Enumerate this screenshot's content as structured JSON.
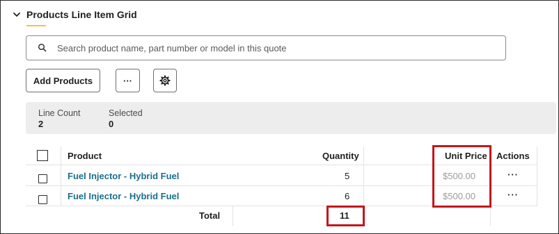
{
  "section": {
    "title": "Products Line Item Grid",
    "chevron_icon": "chevron-down-icon"
  },
  "search": {
    "placeholder": "Search product name, part number or model in this quote",
    "value": "",
    "icon": "search-icon"
  },
  "toolbar": {
    "add_label": "Add Products",
    "more_label": "···",
    "settings_icon": "gear-icon"
  },
  "summary": {
    "line_count_label": "Line Count",
    "line_count_value": "2",
    "selected_label": "Selected",
    "selected_value": "0"
  },
  "table": {
    "columns": {
      "product": "Product",
      "quantity": "Quantity",
      "unit_price": "Unit Price",
      "actions": "Actions"
    },
    "rows": [
      {
        "product": "Fuel Injector - Hybrid Fuel",
        "quantity": "5",
        "unit_price": "$500.00",
        "actions": "···"
      },
      {
        "product": "Fuel Injector - Hybrid Fuel",
        "quantity": "6",
        "unit_price": "$500.00",
        "actions": "···"
      }
    ],
    "total_label": "Total",
    "total_quantity": "11"
  },
  "colors": {
    "link": "#1a6f8d",
    "highlight": "#c3161c",
    "accent_underline": "#f1c24a",
    "summary_bg": "#ededed"
  }
}
